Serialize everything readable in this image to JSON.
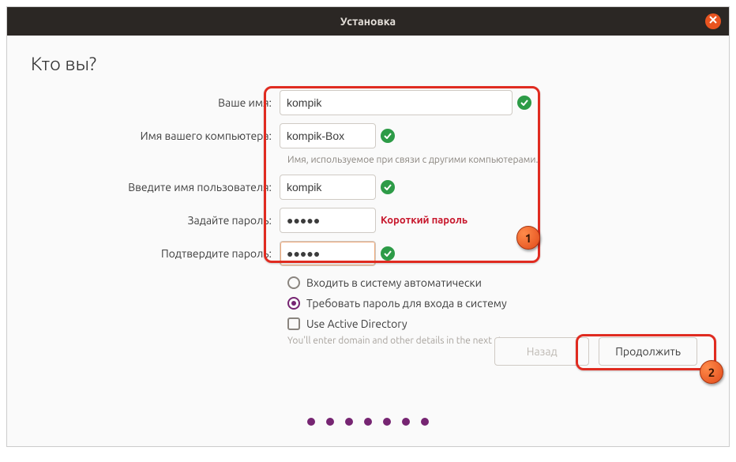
{
  "titlebar": {
    "title": "Установка"
  },
  "page": {
    "heading": "Кто вы?"
  },
  "labels": {
    "name": "Ваше имя:",
    "computer": "Имя вашего компьютера:",
    "computer_hint": "Имя, используемое при связи с другими компьютерами.",
    "username": "Введите имя пользователя:",
    "password": "Задайте пароль:",
    "password_warn": "Короткий пароль",
    "confirm": "Подтвердите пароль:"
  },
  "values": {
    "name": "kompik",
    "computer": "kompik-Box",
    "username": "kompik",
    "password": "●●●●●",
    "confirm": "●●●●●"
  },
  "options": {
    "auto_login": "Входить в систему автоматически",
    "require_pw": "Требовать пароль для входа в систему",
    "use_ad": "Use Active Directory",
    "ad_hint": "You'll enter domain and other details in the next step."
  },
  "buttons": {
    "back": "Назад",
    "continue": "Продолжить"
  },
  "annotations": {
    "step1": "1",
    "step2": "2"
  },
  "colors": {
    "accent": "#762572",
    "brand": "#e95420",
    "ok": "#2d9b47",
    "error": "#c7162b",
    "highlight": "#e02b20"
  }
}
